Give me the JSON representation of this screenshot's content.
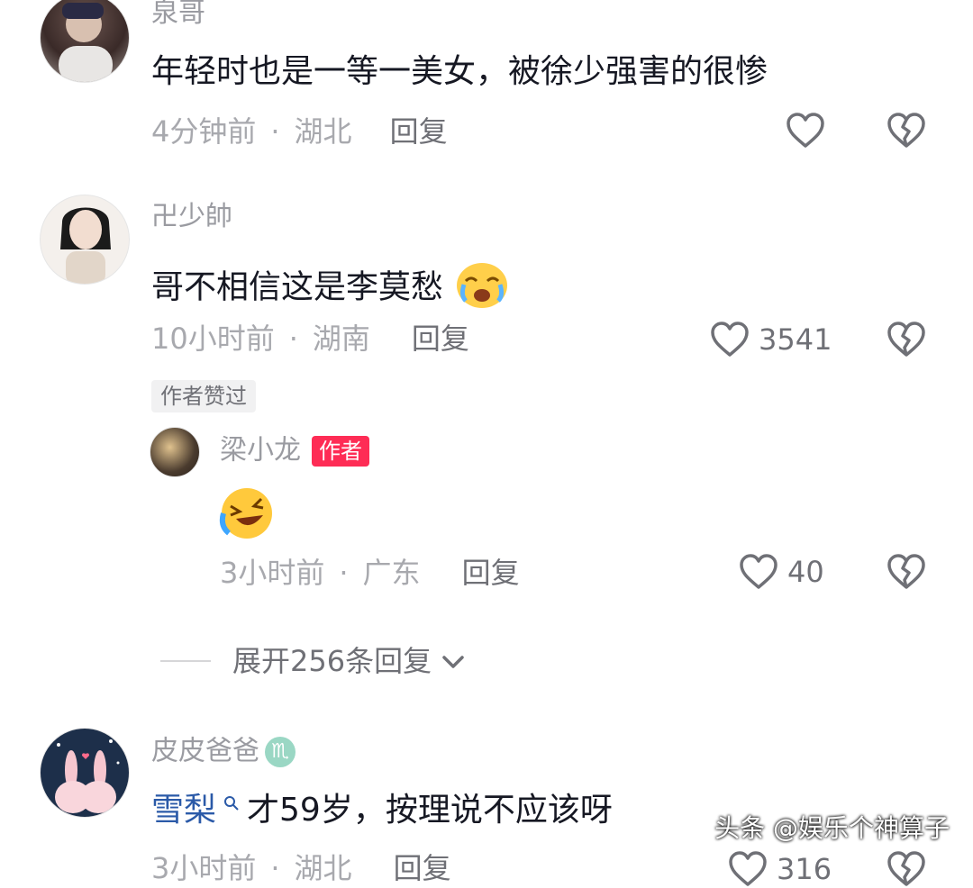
{
  "comments": [
    {
      "username": "泉哥",
      "text": "年轻时也是一等一美女，被徐少强害的很惨",
      "time": "4分钟前",
      "location": "湖北",
      "reply": "回复",
      "likes": ""
    },
    {
      "username": "卍少帥",
      "text": "哥不相信这是李莫愁",
      "time": "10小时前",
      "location": "湖南",
      "reply": "回复",
      "likes": "3541",
      "badge": "作者赞过"
    },
    {
      "username": "皮皮爸爸",
      "mention": "雪梨",
      "text": "才59岁，按理说不应该呀",
      "time": "3小时前",
      "location": "湖北",
      "reply": "回复",
      "likes": "316"
    }
  ],
  "reply": {
    "username": "梁小龙",
    "author_badge": "作者",
    "time": "3小时前",
    "location": "广东",
    "reply": "回复",
    "likes": "40"
  },
  "expand_text": "展开256条回复",
  "separator": "·",
  "zodiac_symbol": "♏",
  "watermark": "头条 @娱乐个神算子",
  "colors": {
    "author_badge_bg": "#fe2c55",
    "mention": "#2b5aa8",
    "meta": "#a8a9ae"
  }
}
